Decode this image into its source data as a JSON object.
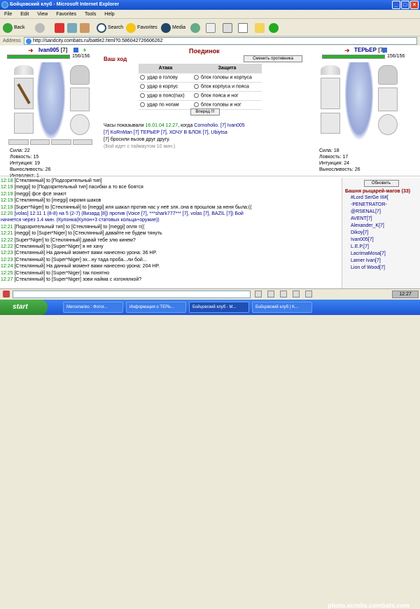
{
  "window": {
    "title": "Бойцовский клуб - Microsoft Internet Explorer"
  },
  "menu": [
    "File",
    "Edit",
    "View",
    "Favorites",
    "Tools",
    "Help"
  ],
  "toolbar": {
    "back": "Back",
    "search": "Search",
    "favorites": "Favorites",
    "media": "Media"
  },
  "address": {
    "label": "Address",
    "url": "http://sandcity.combats.ru/battle2.html?0.586042726606262"
  },
  "battle": {
    "title": "Поединок",
    "turn": "Ваш ход",
    "change_opponent": "Сменить противника",
    "left": {
      "name": "Ivan005",
      "level": "[7]",
      "hp": "156/156",
      "hp_fill": 1.0,
      "stats": [
        "Сила: 22",
        "Ловкость: 15",
        "Интуиция: 19",
        "Выносливость: 26",
        "Интеллект: 1"
      ]
    },
    "right": {
      "name": "ТЕРЬЕР",
      "level": "[7]",
      "hp": "156/156",
      "hp_fill": 1.0,
      "stats": [
        "Сила: 18",
        "Ловкость: 17",
        "Интуиция: 24",
        "Выносливость: 26"
      ]
    },
    "attack_header": "Атака",
    "defense_header": "Защита",
    "attack": [
      "удар в голову",
      "удар в корпус",
      "удар в пояс(пах)",
      "удар по ногам"
    ],
    "defense": [
      "блок головы и корпуса",
      "блок корпуса и пояса",
      "блок пояса и ног",
      "блок головы и ног"
    ],
    "go_button": "Вперед !!!",
    "clock_text": "Часы показывали",
    "clock_date": "16.01.04 12:27",
    "clock_when": ", когда",
    "line1_names": "Cornoholio. [7] Ivan005",
    "line2_names": "[7] KoRnMan [7] ТЕРЬЕР [7], ХОЧУ В БЛОК [7], Ubiytsa",
    "line3": "[7] бросили вызов друг другу.",
    "line4": "(Бой идет с таймаутом 10 мин.)"
  },
  "log": [
    {
      "time": "12:18",
      "text": "[Стеклянный] to [Подозрительный тип]"
    },
    {
      "time": "12:19",
      "text": "[meggi] to [Подозрительный тип] пасибки а то все боятся"
    },
    {
      "time": "12:19",
      "text": "[meggi] фсе фсё знают"
    },
    {
      "time": "12:19",
      "text": "[Стеклянный] to [meggi] окромя шаков"
    },
    {
      "time": "12:19",
      "text": "[Super*Niger] to [Стеклянный] to [meggi] иля шакал против нас у неё зля..она в прошлом за неня была:(("
    },
    {
      "time": "12:20",
      "text": "[volas] 12:11 1 (8-8) на 5 (2-7) (Визард [8]) против (Voice [7], ***shark777*** [7], volas [7], BAZIL [7]) Бой"
    },
    {
      "time": "",
      "text": "начнется через 1.4 мин. (Кулонка(Кулон+3 статовых кольца+оружие))"
    },
    {
      "time": "12:21",
      "text": "[Подозрительный тип] to [Стеклянный] to [meggi] опля =(("
    },
    {
      "time": "12:21",
      "text": "[meggi] to [Super*Niger] to [Стеклянный] давайте не будем тянуть"
    },
    {
      "time": "12:22",
      "text": "[Super*Niger] to [Стеклянный] давай тебе злю кинем?"
    },
    {
      "time": "12:22",
      "text": "[Стеклянный] to [Super*Niger] я не хачу"
    },
    {
      "time": "12:23",
      "text": "[Стеклянный] На данный момент вами нанесено урона: 36 HP."
    },
    {
      "time": "12:23",
      "text": "[Стеклянный] to [Super*Niger] эх...ну тада проба...ли бой..."
    },
    {
      "time": "12:24",
      "text": "[Стеклянный] На данный момент вами нанесено урона: 204 HP."
    },
    {
      "time": "12:25",
      "text": "[Стеклянный] to [Super*Niger] так понятно"
    },
    {
      "time": "12:27",
      "text": "[Стеклянный] to [Super*Niger] зови найма с изгонялкой?"
    }
  ],
  "userlist": {
    "refresh": "Обновить",
    "title": "Башня рыцарей-магов (33)",
    "users": [
      "#Lord SerGe III#[",
      "-PENETRATOR-",
      "@RSENAL[7]",
      "AVENT[7]",
      "Alexander_K[7]",
      "Dikoy[7]",
      "Ivan005[7]",
      "L.E.P.[7]",
      "LacrimaMosa[7]",
      "Lamer Ivan[7]",
      "Lion of Wood[7]"
    ]
  },
  "taskbar": {
    "start": "start",
    "tasks": [
      "Mercenaries : Фотог...",
      "Информация о ТЕРЬ...",
      "Бойцовский клуб - M...",
      "Бойцовский клуб | K..."
    ],
    "clock": "12:27",
    "watermark": "photo.scrolls.combats.com"
  },
  "colors": {
    "hp": "#2db02d",
    "name": "#00008b",
    "title": "#8b0000",
    "time": "#008800"
  }
}
